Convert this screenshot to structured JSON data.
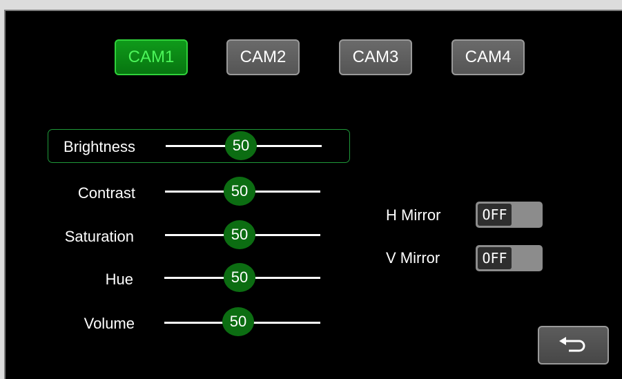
{
  "tabs": [
    {
      "label": "CAM1",
      "active": true
    },
    {
      "label": "CAM2",
      "active": false
    },
    {
      "label": "CAM3",
      "active": false
    },
    {
      "label": "CAM4",
      "active": false
    }
  ],
  "sliders": [
    {
      "label": "Brightness",
      "value": "50"
    },
    {
      "label": "Contrast",
      "value": "50"
    },
    {
      "label": "Saturation",
      "value": "50"
    },
    {
      "label": "Hue",
      "value": "50"
    },
    {
      "label": "Volume",
      "value": "50"
    }
  ],
  "mirrors": [
    {
      "label": "H Mirror",
      "state": "OFF"
    },
    {
      "label": "V Mirror",
      "state": "OFF"
    }
  ],
  "back_button": {
    "icon": "return-arrow-icon"
  },
  "colors": {
    "active_tab": "#0c8a16",
    "active_text": "#4cf55a",
    "knob": "#0c6d12",
    "focus_border": "#1f9a3a",
    "background": "#000000"
  }
}
